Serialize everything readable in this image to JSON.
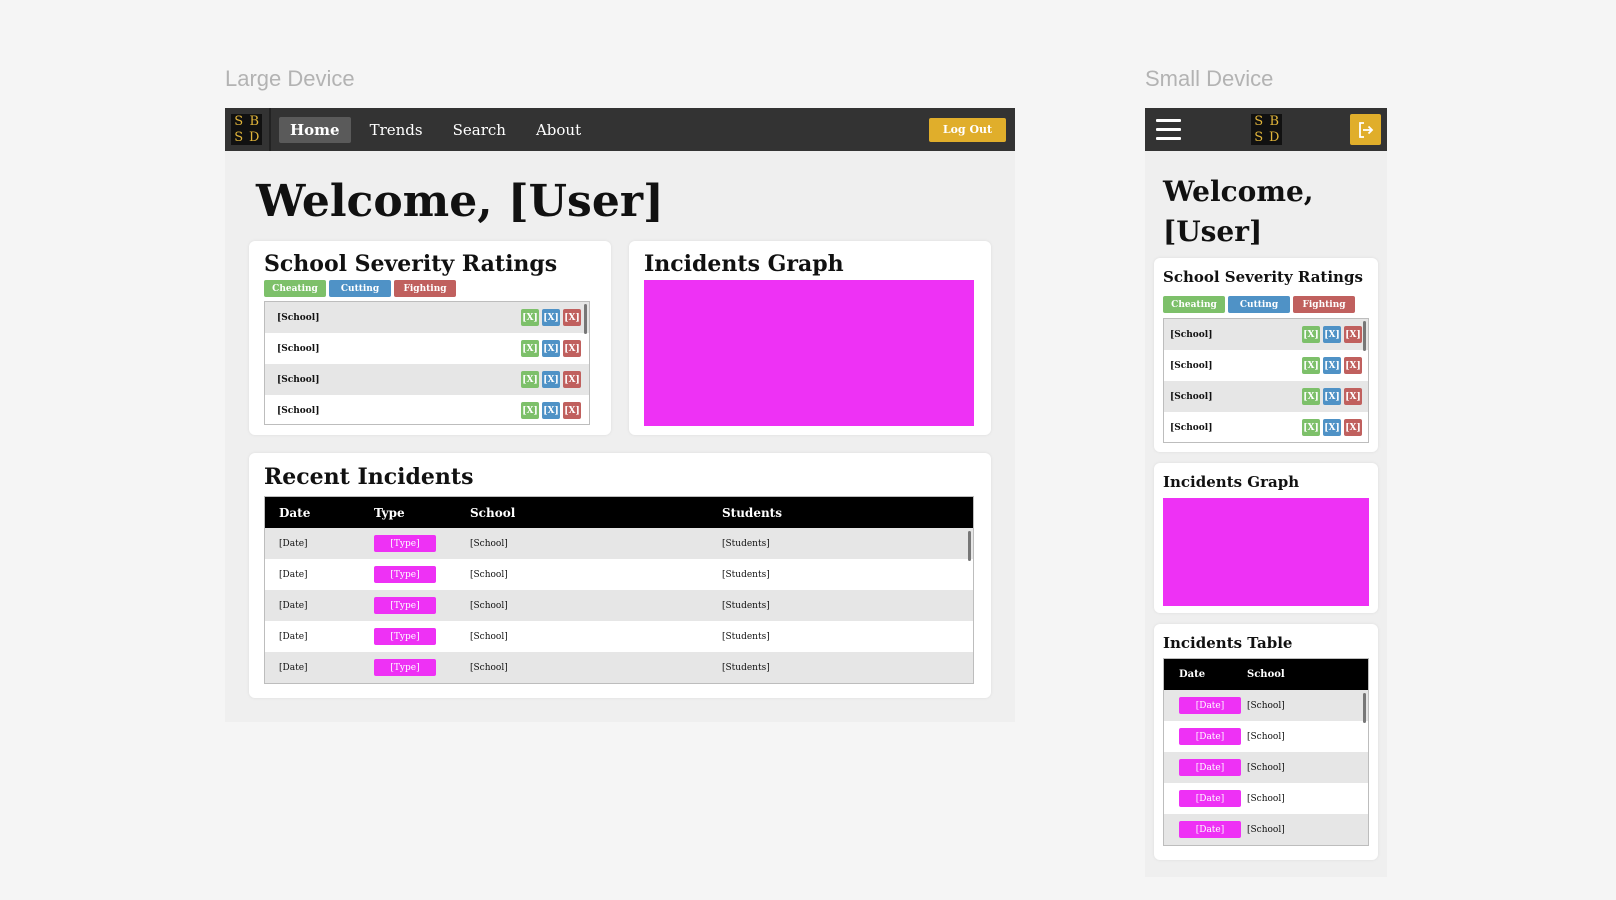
{
  "labels": {
    "large_device": "Large Device",
    "small_device": "Small Device"
  },
  "brand": {
    "logo": [
      "S",
      "B",
      "S",
      "D"
    ],
    "accent_color": "#e0ae2b",
    "graph_color": "#ee31f5"
  },
  "large": {
    "nav": {
      "items": [
        "Home",
        "Trends",
        "Search",
        "About"
      ],
      "active": "Home",
      "logout_label": "Log Out"
    },
    "welcome": "Welcome, [User]",
    "severity": {
      "title": "School Severity Ratings",
      "chips": [
        "Cheating",
        "Cutting",
        "Fighting"
      ],
      "rows": [
        {
          "school": "[School]",
          "ratings": [
            "[X]",
            "[X]",
            "[X]"
          ]
        },
        {
          "school": "[School]",
          "ratings": [
            "[X]",
            "[X]",
            "[X]"
          ]
        },
        {
          "school": "[School]",
          "ratings": [
            "[X]",
            "[X]",
            "[X]"
          ]
        },
        {
          "school": "[School]",
          "ratings": [
            "[X]",
            "[X]",
            "[X]"
          ]
        }
      ]
    },
    "graph": {
      "title": "Incidents Graph"
    },
    "recent": {
      "title": "Recent Incidents",
      "columns": [
        "Date",
        "Type",
        "School",
        "Students"
      ],
      "rows": [
        {
          "date": "[Date]",
          "type": "[Type]",
          "school": "[School]",
          "students": "[Students]"
        },
        {
          "date": "[Date]",
          "type": "[Type]",
          "school": "[School]",
          "students": "[Students]"
        },
        {
          "date": "[Date]",
          "type": "[Type]",
          "school": "[School]",
          "students": "[Students]"
        },
        {
          "date": "[Date]",
          "type": "[Type]",
          "school": "[School]",
          "students": "[Students]"
        },
        {
          "date": "[Date]",
          "type": "[Type]",
          "school": "[School]",
          "students": "[Students]"
        }
      ]
    }
  },
  "small": {
    "nav": {
      "menu_icon": "hamburger-icon",
      "logout_icon": "logout-icon"
    },
    "welcome": "Welcome, [User]",
    "severity": {
      "title": "School Severity Ratings",
      "chips": [
        "Cheating",
        "Cutting",
        "Fighting"
      ],
      "rows": [
        {
          "school": "[School]",
          "ratings": [
            "[X]",
            "[X]",
            "[X]"
          ]
        },
        {
          "school": "[School]",
          "ratings": [
            "[X]",
            "[X]",
            "[X]"
          ]
        },
        {
          "school": "[School]",
          "ratings": [
            "[X]",
            "[X]",
            "[X]"
          ]
        },
        {
          "school": "[School]",
          "ratings": [
            "[X]",
            "[X]",
            "[X]"
          ]
        }
      ]
    },
    "graph": {
      "title": "Incidents Graph"
    },
    "table": {
      "title": "Incidents Table",
      "columns": [
        "Date",
        "School"
      ],
      "rows": [
        {
          "date": "[Date]",
          "school": "[School]"
        },
        {
          "date": "[Date]",
          "school": "[School]"
        },
        {
          "date": "[Date]",
          "school": "[School]"
        },
        {
          "date": "[Date]",
          "school": "[School]"
        },
        {
          "date": "[Date]",
          "school": "[School]"
        }
      ]
    }
  }
}
